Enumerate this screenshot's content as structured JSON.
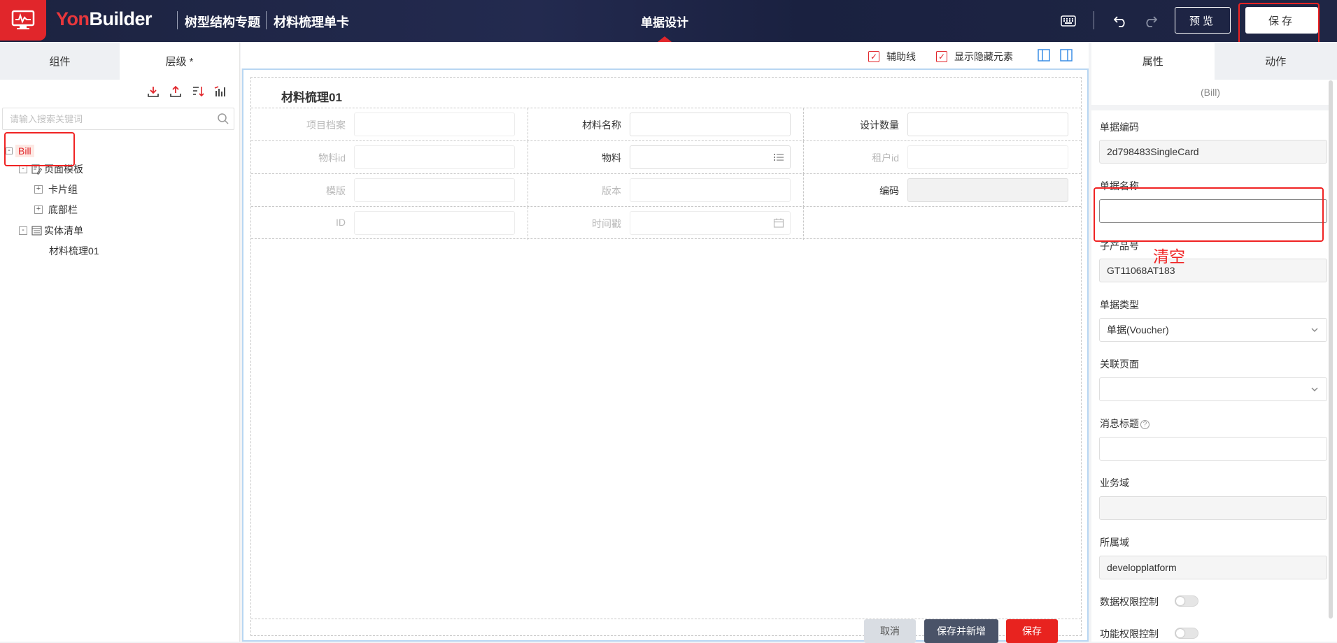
{
  "header": {
    "brand_yon": "Yon",
    "brand_builder": "Builder",
    "crumb1": "树型结构专题",
    "crumb2": "材料梳理单卡",
    "center_title": "单据设计",
    "preview_label": "预览",
    "save_label": "保存"
  },
  "left": {
    "tabs": [
      {
        "label": "组件"
      },
      {
        "label": "层级 *"
      }
    ],
    "search_placeholder": "请输入搜索关键词",
    "tree": {
      "bill": "Bill",
      "page_template": "页面模板",
      "card_group": "卡片组",
      "bottom_bar": "底部栏",
      "entity_list": "实体清单",
      "entity_item": "材料梳理01"
    }
  },
  "canvas": {
    "aux_lines_label": "辅助线",
    "show_hidden_label": "显示隐藏元素",
    "form_title": "材料梳理01",
    "rows": [
      [
        {
          "label": "项目档案"
        },
        {
          "label": "材料名称"
        },
        {
          "label": "设计数量"
        }
      ],
      [
        {
          "label": "物料id"
        },
        {
          "label": "物料"
        },
        {
          "label": "租户id"
        }
      ],
      [
        {
          "label": "模版"
        },
        {
          "label": "版本"
        },
        {
          "label": "编码"
        }
      ],
      [
        {
          "label": "ID"
        },
        {
          "label": "时间戳"
        }
      ]
    ],
    "footer": {
      "cancel": "取消",
      "save_new": "保存并新增",
      "save": "保存"
    }
  },
  "right": {
    "tabs": [
      {
        "label": "属性"
      },
      {
        "label": "动作"
      }
    ],
    "bill_sub": "(Bill)",
    "fields": {
      "code_label": "单据编码",
      "code_value": "2d798483SingleCard",
      "name_label": "单据名称",
      "name_value": "",
      "subproduct_label": "子产品号",
      "subproduct_value": "GT11068AT183",
      "type_label": "单据类型",
      "type_value": "单据(Voucher)",
      "link_page_label": "关联页面",
      "link_page_value": "",
      "msg_title_label": "消息标题",
      "msg_title_value": "",
      "biz_domain_label": "业务域",
      "biz_domain_value": "",
      "owner_domain_label": "所属域",
      "owner_domain_value": "developplatform",
      "data_perm_label": "数据权限控制",
      "func_perm_label": "功能权限控制"
    },
    "annotation_note": "清空"
  },
  "colors": {
    "accent": "#e1262b",
    "header_bg": "#1c2340",
    "link_blue": "#3a8ee6",
    "annotation_red": "#f02323"
  }
}
